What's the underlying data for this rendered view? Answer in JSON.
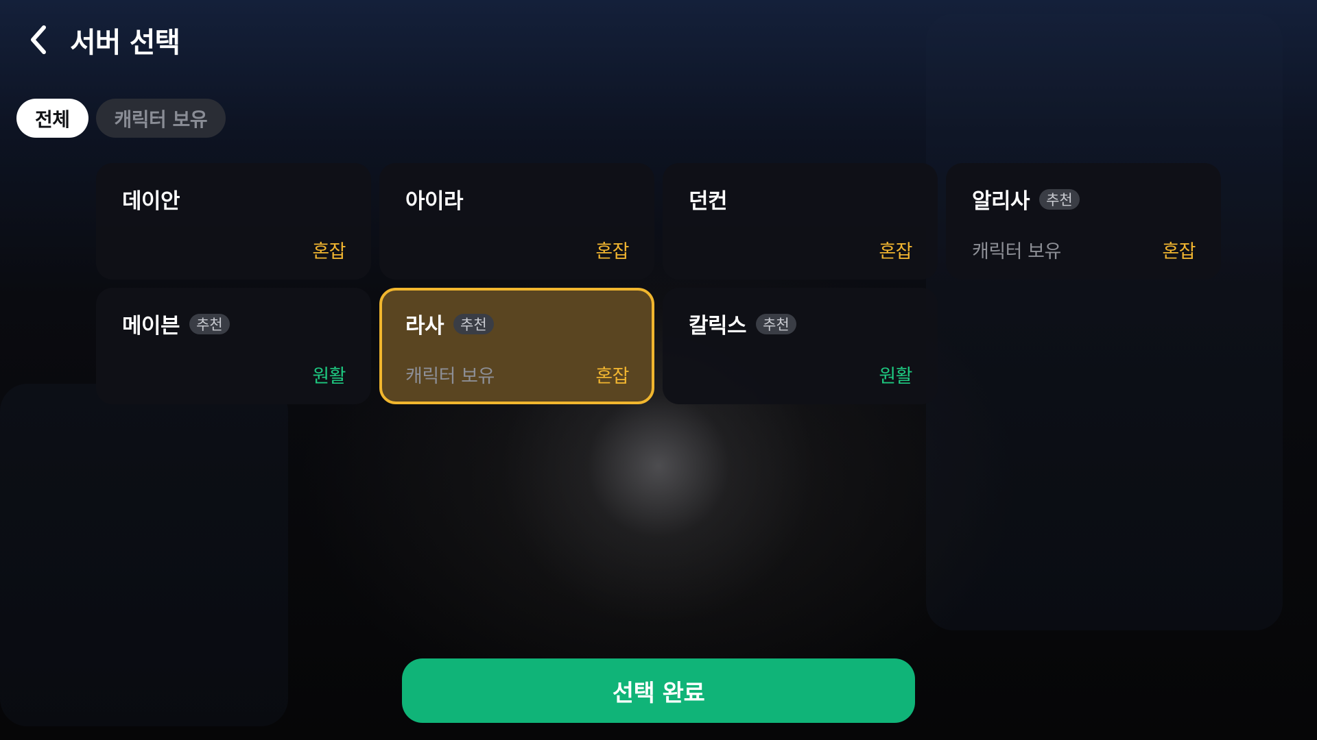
{
  "header": {
    "title": "서버 선택",
    "back_icon": "chevron-left-icon"
  },
  "filters": [
    {
      "label": "전체",
      "active": true
    },
    {
      "label": "캐릭터 보유",
      "active": false
    }
  ],
  "servers": [
    {
      "name": "데이안",
      "recommended": false,
      "recommended_label": "",
      "char_owned": "",
      "status": "혼잡",
      "status_type": "busy",
      "selected": false
    },
    {
      "name": "아이라",
      "recommended": false,
      "recommended_label": "",
      "char_owned": "",
      "status": "혼잡",
      "status_type": "busy",
      "selected": false
    },
    {
      "name": "던컨",
      "recommended": false,
      "recommended_label": "",
      "char_owned": "",
      "status": "혼잡",
      "status_type": "busy",
      "selected": false
    },
    {
      "name": "알리사",
      "recommended": true,
      "recommended_label": "추천",
      "char_owned": "캐릭터 보유",
      "status": "혼잡",
      "status_type": "busy",
      "selected": false
    },
    {
      "name": "메이븐",
      "recommended": true,
      "recommended_label": "추천",
      "char_owned": "",
      "status": "원활",
      "status_type": "smooth",
      "selected": false
    },
    {
      "name": "라사",
      "recommended": true,
      "recommended_label": "추천",
      "char_owned": "캐릭터 보유",
      "status": "혼잡",
      "status_type": "busy",
      "selected": true
    },
    {
      "name": "칼릭스",
      "recommended": true,
      "recommended_label": "추천",
      "char_owned": "",
      "status": "원활",
      "status_type": "smooth",
      "selected": false
    }
  ],
  "confirm_button": {
    "label": "선택 완료"
  },
  "colors": {
    "accent_green": "#10b478",
    "busy": "#f1b530",
    "smooth": "#1ec880",
    "selected_border": "#f1b62e",
    "selected_fill": "#5a4521"
  }
}
